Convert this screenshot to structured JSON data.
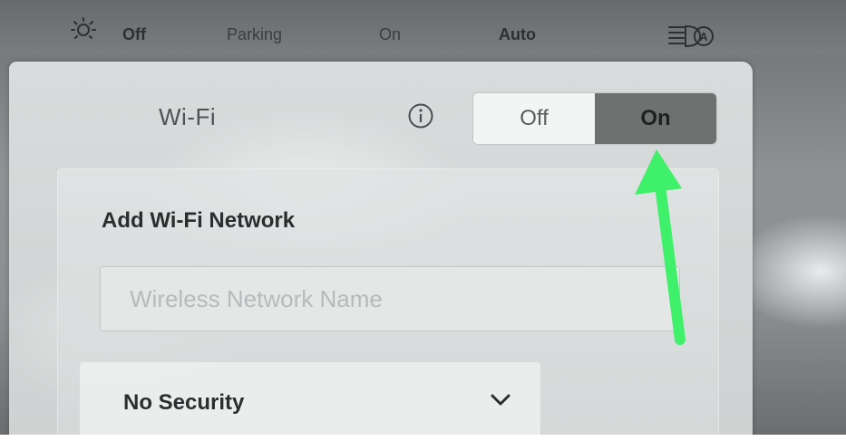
{
  "lighting_bar": {
    "items": [
      {
        "label": "Off"
      },
      {
        "label": "Parking"
      },
      {
        "label": "On"
      },
      {
        "label": "Auto"
      }
    ],
    "icons": [
      "sun-icon",
      "auto-high-beam-icon"
    ]
  },
  "wifi": {
    "label": "Wi-Fi",
    "info_icon": "info-icon",
    "toggle": {
      "options": [
        "Off",
        "On"
      ],
      "selected": "On"
    }
  },
  "add_network": {
    "title": "Add Wi-Fi Network",
    "network_name_placeholder": "Wireless Network Name",
    "security": {
      "value": "No Security",
      "icon": "chevron-down-icon"
    }
  },
  "annotation": {
    "arrow_color": "#3ff06a"
  },
  "colors": {
    "toggle_selected": "#6e7170",
    "toggle_unselected": "#f3f4f4",
    "panel": "#d6d9d9"
  }
}
